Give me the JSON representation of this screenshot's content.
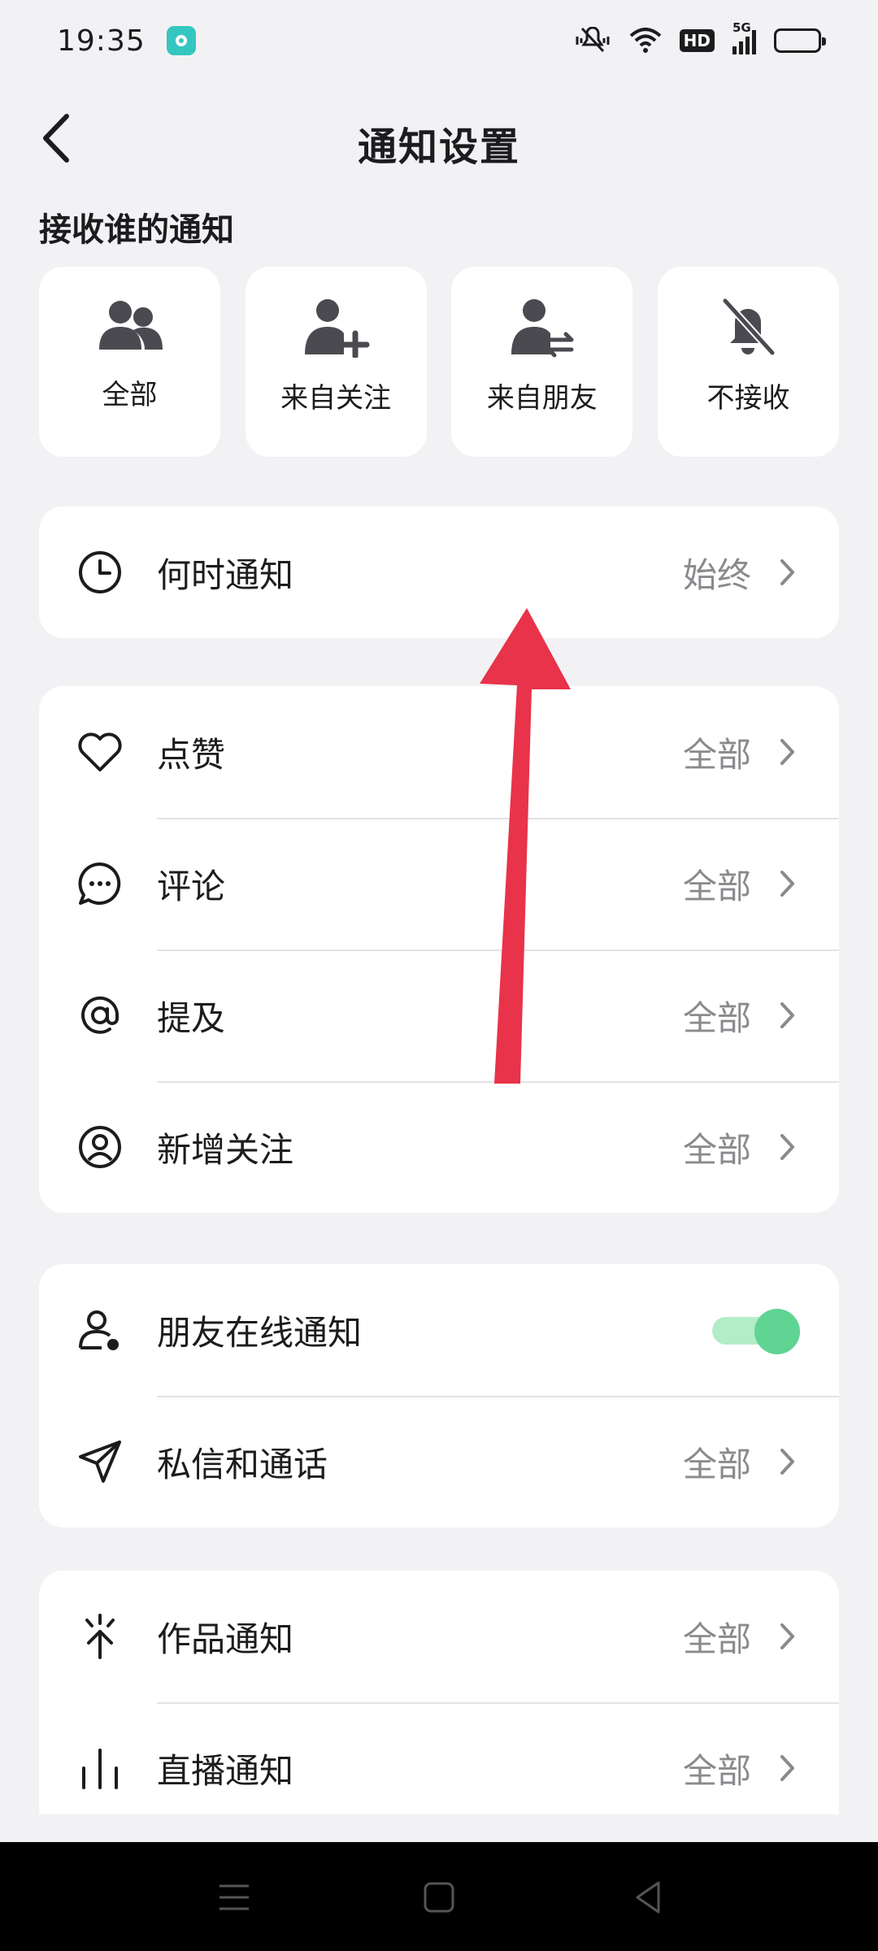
{
  "status_bar": {
    "time": "19:35",
    "network": "5G",
    "hd": "HD"
  },
  "header": {
    "title": "通知设置"
  },
  "receive_section": {
    "title": "接收谁的通知",
    "options": [
      {
        "label": "全部",
        "icon": "people-icon"
      },
      {
        "label": "来自关注",
        "icon": "person-add-icon"
      },
      {
        "label": "来自朋友",
        "icon": "person-swap-icon"
      },
      {
        "label": "不接收",
        "icon": "bell-off-icon"
      }
    ]
  },
  "when_group": {
    "items": [
      {
        "label": "何时通知",
        "value": "始终",
        "icon": "clock-icon"
      }
    ]
  },
  "interaction_group": {
    "items": [
      {
        "label": "点赞",
        "value": "全部",
        "icon": "heart-icon"
      },
      {
        "label": "评论",
        "value": "全部",
        "icon": "comment-icon"
      },
      {
        "label": "提及",
        "value": "全部",
        "icon": "at-icon"
      },
      {
        "label": "新增关注",
        "value": "全部",
        "icon": "user-circle-icon"
      }
    ]
  },
  "friends_group": {
    "items": [
      {
        "label": "朋友在线通知",
        "toggle_on": true,
        "icon": "user-online-icon"
      },
      {
        "label": "私信和通话",
        "value": "全部",
        "icon": "paper-plane-icon"
      }
    ]
  },
  "content_group": {
    "items": [
      {
        "label": "作品通知",
        "value": "全部",
        "icon": "sparkle-icon"
      },
      {
        "label": "直播通知",
        "value": "全部",
        "icon": "bars-icon"
      }
    ]
  },
  "colors": {
    "background": "#f2f2f4",
    "card": "#ffffff",
    "secondary_text": "#8a8a8e",
    "toggle_on": "#5fd493",
    "annotation_arrow": "#e8334a"
  }
}
